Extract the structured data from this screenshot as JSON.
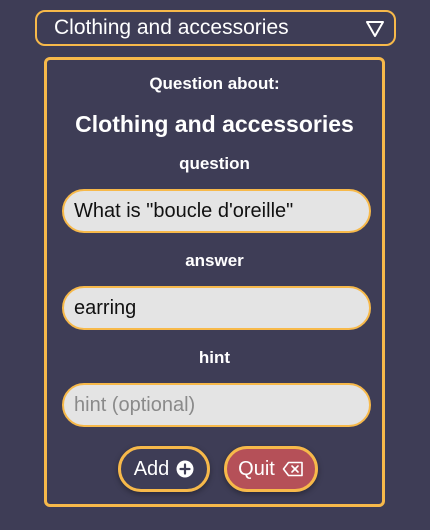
{
  "topic_select": {
    "selected": "Clothing and accessories",
    "icon": "triangle-down-icon"
  },
  "form": {
    "about_label": "Question about:",
    "topic_title": "Clothing and accessories",
    "question_label": "question",
    "question_value": "What is \"boucle d'oreille\"",
    "answer_label": "answer",
    "answer_value": "earring",
    "hint_label": "hint",
    "hint_value": "",
    "hint_placeholder": "hint (optional)"
  },
  "buttons": {
    "add_label": "Add",
    "add_icon": "plus-circle-icon",
    "quit_label": "Quit",
    "quit_icon": "backspace-icon"
  },
  "colors": {
    "background": "#3e3d56",
    "accent": "#f7b94a",
    "field_bg": "#e4e4e4",
    "quit_bg": "#b55058"
  }
}
